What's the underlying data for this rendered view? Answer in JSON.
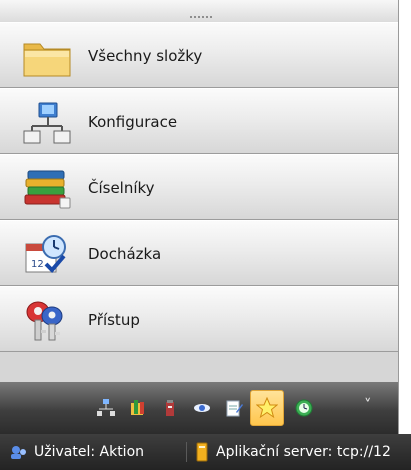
{
  "nav": {
    "items": [
      {
        "label": "Všechny složky",
        "icon": "folder-icon"
      },
      {
        "label": "Konfigurace",
        "icon": "network-icon"
      },
      {
        "label": "Číselníky",
        "icon": "books-icon"
      },
      {
        "label": "Docházka",
        "icon": "calendar-clock-icon"
      },
      {
        "label": "Přístup",
        "icon": "keys-icon"
      }
    ]
  },
  "toolbar": {
    "buttons": [
      "network-small-icon",
      "folders-small-icon",
      "tower-icon",
      "eye-icon",
      "notepad-icon",
      "star-icon",
      "clock-icon"
    ],
    "active": "star-icon",
    "overflow_symbol": "˅"
  },
  "status": {
    "user_label": "Uživatel: Aktion",
    "server_label": "Aplikační server: tcp://12"
  }
}
